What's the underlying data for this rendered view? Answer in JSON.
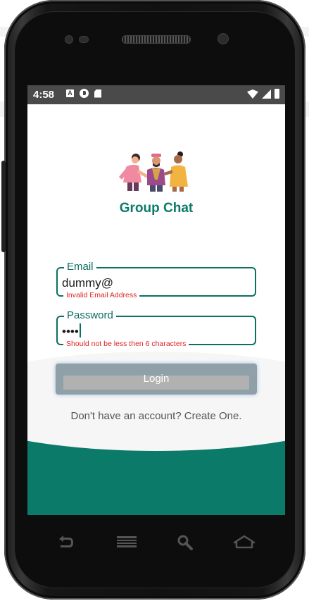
{
  "status_bar": {
    "time": "4:58",
    "left_icons": [
      "a-notification-icon",
      "sync-icon",
      "sd-card-icon"
    ],
    "right_icons": [
      "wifi-icon",
      "signal-icon",
      "battery-icon"
    ],
    "a_icon_letter": "A"
  },
  "app": {
    "title": "Group Chat",
    "accent_color": "#0b7a69",
    "error_color": "#e02424"
  },
  "form": {
    "email": {
      "label": "Email",
      "value": "dummy@",
      "error": "Invalid Email Address"
    },
    "password": {
      "label": "Password",
      "value": "••••",
      "error": "Should not be less then 6 characters"
    },
    "login_label": "Login",
    "signup_prompt": "Don't have an account? Create One."
  },
  "device_nav": [
    "back-icon",
    "menu-icon",
    "search-icon",
    "home-icon"
  ]
}
